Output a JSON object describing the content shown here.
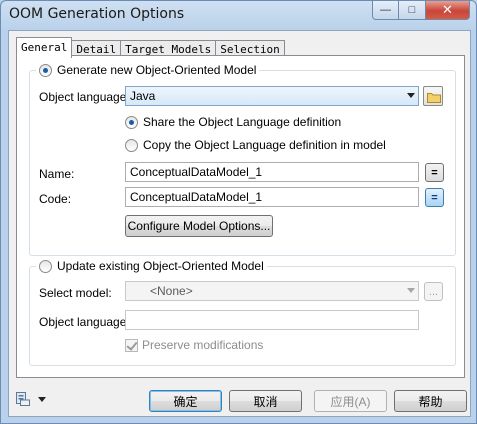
{
  "window": {
    "title": "OOM Generation Options",
    "controls": {
      "minimize": "—",
      "maximize": "□",
      "close": "✕"
    }
  },
  "tabs": [
    {
      "label": "General",
      "active": true
    },
    {
      "label": "Detail",
      "active": false
    },
    {
      "label": "Target Models",
      "active": false
    },
    {
      "label": "Selection",
      "active": false
    }
  ],
  "generate_group": {
    "radio_label": "Generate new Object-Oriented Model",
    "selected": true,
    "object_language_label": "Object language:",
    "object_language_value": "Java",
    "share_label": "Share the Object Language definition",
    "share_selected": true,
    "copy_label": "Copy the Object Language definition in model",
    "copy_selected": false,
    "name_label": "Name:",
    "name_value": "ConceptualDataModel_1",
    "code_label": "Code:",
    "code_value": "ConceptualDataModel_1",
    "equals_glyph": "=",
    "configure_button": "Configure Model Options..."
  },
  "update_group": {
    "radio_label": "Update existing Object-Oriented Model",
    "selected": false,
    "select_model_label": "Select model:",
    "select_model_value": "<None>",
    "browse_glyph": "...",
    "object_language_label": "Object language:",
    "object_language_value": "",
    "preserve_label": "Preserve modifications",
    "preserve_checked": true
  },
  "buttons": {
    "ok": "确定",
    "cancel": "取消",
    "apply": "应用(A)",
    "help": "帮助"
  },
  "icons": {
    "bottom_left": "object-browser-icon",
    "folder": "folder-icon"
  }
}
